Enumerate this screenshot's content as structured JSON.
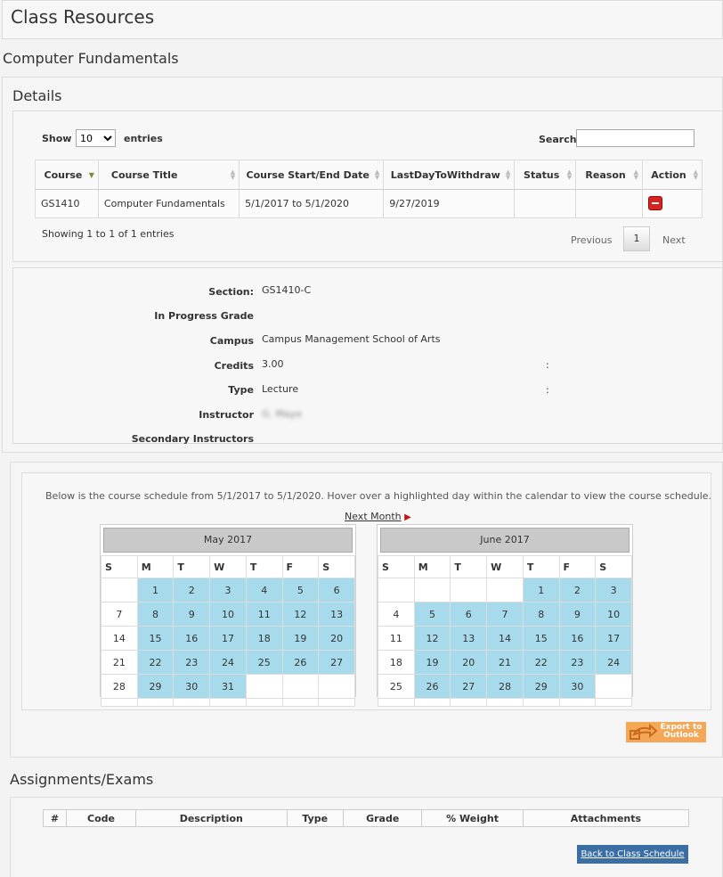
{
  "page": {
    "title": "Class Resources",
    "course_heading": "Computer Fundamentals",
    "details_heading": "Details"
  },
  "table_controls": {
    "show_label": "Show",
    "entries_label": "entries",
    "page_size": "10",
    "search_label": "Search",
    "search_value": ""
  },
  "table": {
    "columns": [
      "Course",
      "Course Title",
      "Course Start/End Date",
      "LastDayToWithdraw",
      "Status",
      "Reason",
      "Action"
    ],
    "rows": [
      {
        "course": "GS1410",
        "title": "Computer Fundamentals",
        "dates": "5/1/2017 to 5/1/2020",
        "withdraw": "9/27/2019",
        "status": "",
        "reason": ""
      }
    ],
    "info": "Showing 1 to 1 of 1 entries",
    "pagination": {
      "previous": "Previous",
      "page": "1",
      "next": "Next"
    }
  },
  "section_details": {
    "section_label": "Section:",
    "section_value": "GS1410-C",
    "grade_label": "In Progress Grade",
    "grade_value": "",
    "campus_label": "Campus",
    "campus_value": "Campus Management School of Arts",
    "credits_label": "Credits",
    "credits_value": "3.00",
    "credits_colon": ":",
    "type_label": "Type",
    "type_value": "Lecture",
    "type_colon": ":",
    "instructor_label": "Instructor",
    "instructor_value": "G. Maye",
    "secondary_label": "Secondary Instructors"
  },
  "schedule": {
    "intro": "Below is the course schedule from 5/1/2017 to 5/1/2020. Hover over a highlighted day within the calendar to view the course schedule.",
    "next_month": "Next Month",
    "weekdays": [
      "S",
      "M",
      "T",
      "W",
      "T",
      "F",
      "S"
    ],
    "highlight_color": "#a7dbeb",
    "months": [
      {
        "name": "May 2017",
        "weeks": [
          [
            "",
            "1",
            "2",
            "3",
            "4",
            "5",
            "6"
          ],
          [
            "7",
            "8",
            "9",
            "10",
            "11",
            "12",
            "13"
          ],
          [
            "14",
            "15",
            "16",
            "17",
            "18",
            "19",
            "20"
          ],
          [
            "21",
            "22",
            "23",
            "24",
            "25",
            "26",
            "27"
          ],
          [
            "28",
            "29",
            "30",
            "31",
            "",
            "",
            ""
          ]
        ],
        "highlighted": [
          "1",
          "2",
          "3",
          "4",
          "5",
          "6",
          "8",
          "9",
          "10",
          "11",
          "12",
          "13",
          "15",
          "16",
          "17",
          "18",
          "19",
          "20",
          "22",
          "23",
          "24",
          "25",
          "26",
          "27",
          "29",
          "30",
          "31"
        ]
      },
      {
        "name": "June 2017",
        "weeks": [
          [
            "",
            "",
            "",
            "",
            "1",
            "2",
            "3"
          ],
          [
            "4",
            "5",
            "6",
            "7",
            "8",
            "9",
            "10"
          ],
          [
            "11",
            "12",
            "13",
            "14",
            "15",
            "16",
            "17"
          ],
          [
            "18",
            "19",
            "20",
            "21",
            "22",
            "23",
            "24"
          ],
          [
            "25",
            "26",
            "27",
            "28",
            "29",
            "30",
            ""
          ]
        ],
        "highlighted": [
          "1",
          "2",
          "3",
          "5",
          "6",
          "7",
          "8",
          "9",
          "10",
          "12",
          "13",
          "14",
          "15",
          "16",
          "17",
          "19",
          "20",
          "21",
          "22",
          "23",
          "24",
          "26",
          "27",
          "28",
          "29",
          "30"
        ]
      }
    ],
    "export_label": "Export to Outlook",
    "export_color": "#f4a857"
  },
  "assignments": {
    "heading": "Assignments/Exams",
    "columns": [
      "#",
      "Code",
      "Description",
      "Type",
      "Grade",
      "% Weight",
      "Attachments"
    ],
    "back_button": "Back to Class Schedule",
    "button_color": "#3a6ea5"
  }
}
